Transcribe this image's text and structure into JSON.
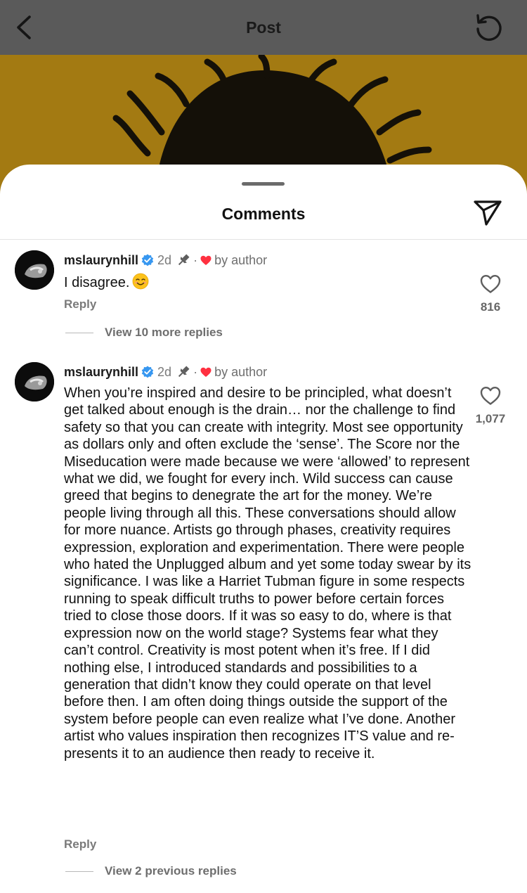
{
  "header": {
    "title": "Post",
    "back_icon": "chevron-left-icon",
    "refresh_icon": "refresh-icon"
  },
  "sheet": {
    "title": "Comments",
    "share_icon": "paper-plane-icon"
  },
  "comments": [
    {
      "username": "mslaurynhill",
      "verified": true,
      "time": "2d",
      "separator": "·",
      "author_liked_label": "by author",
      "text": "I disagree.",
      "emoji": "smiling-face-icon",
      "reply_label": "Reply",
      "like_count": "816",
      "view_replies_label": "View 10 more replies"
    },
    {
      "username": "mslaurynhill",
      "verified": true,
      "time": "2d",
      "separator": "·",
      "author_liked_label": "by author",
      "text": "When you’re inspired and desire to be principled, what doesn’t get talked about enough is the drain… nor the challenge to find safety so that you can create with integrity.  Most see opportunity as dollars only and often exclude the ‘sense’. The Score nor the Miseducation were  made because we were ‘allowed’ to represent what we did, we fought for every inch.  Wild success can cause greed that begins to denegrate the art for the money. We’re people living through all this. These conversations should allow for more nuance.  Artists go through phases, creativity requires expression, exploration and experimentation. There were people who hated the Unplugged album and yet some today swear by its significance. I was like a Harriet Tubman figure in some respects running to speak difficult truths to power before certain forces tried to close those doors. If it was so easy to do, where is that expression now on the world stage? Systems fear what they can’t control. Creativity is most potent when it’s free. If I did nothing else, I introduced standards and possibilities to a generation that didn’t know they could operate on that level before then.  I am often doing things outside the support of the system before people can even realize what I’ve done. Another artist who values inspiration then recognizes IT’S value and re-presents it to an audience then ready to receive it.",
      "reply_label": "Reply",
      "like_count": "1,077",
      "view_replies_label": "View 2 previous replies"
    }
  ],
  "colors": {
    "topbar": "#5a5a5a",
    "post_image": "#a37a12",
    "verified": "#3797f0",
    "heart_red": "#ff3040",
    "muted_text": "#7a7a7a"
  }
}
